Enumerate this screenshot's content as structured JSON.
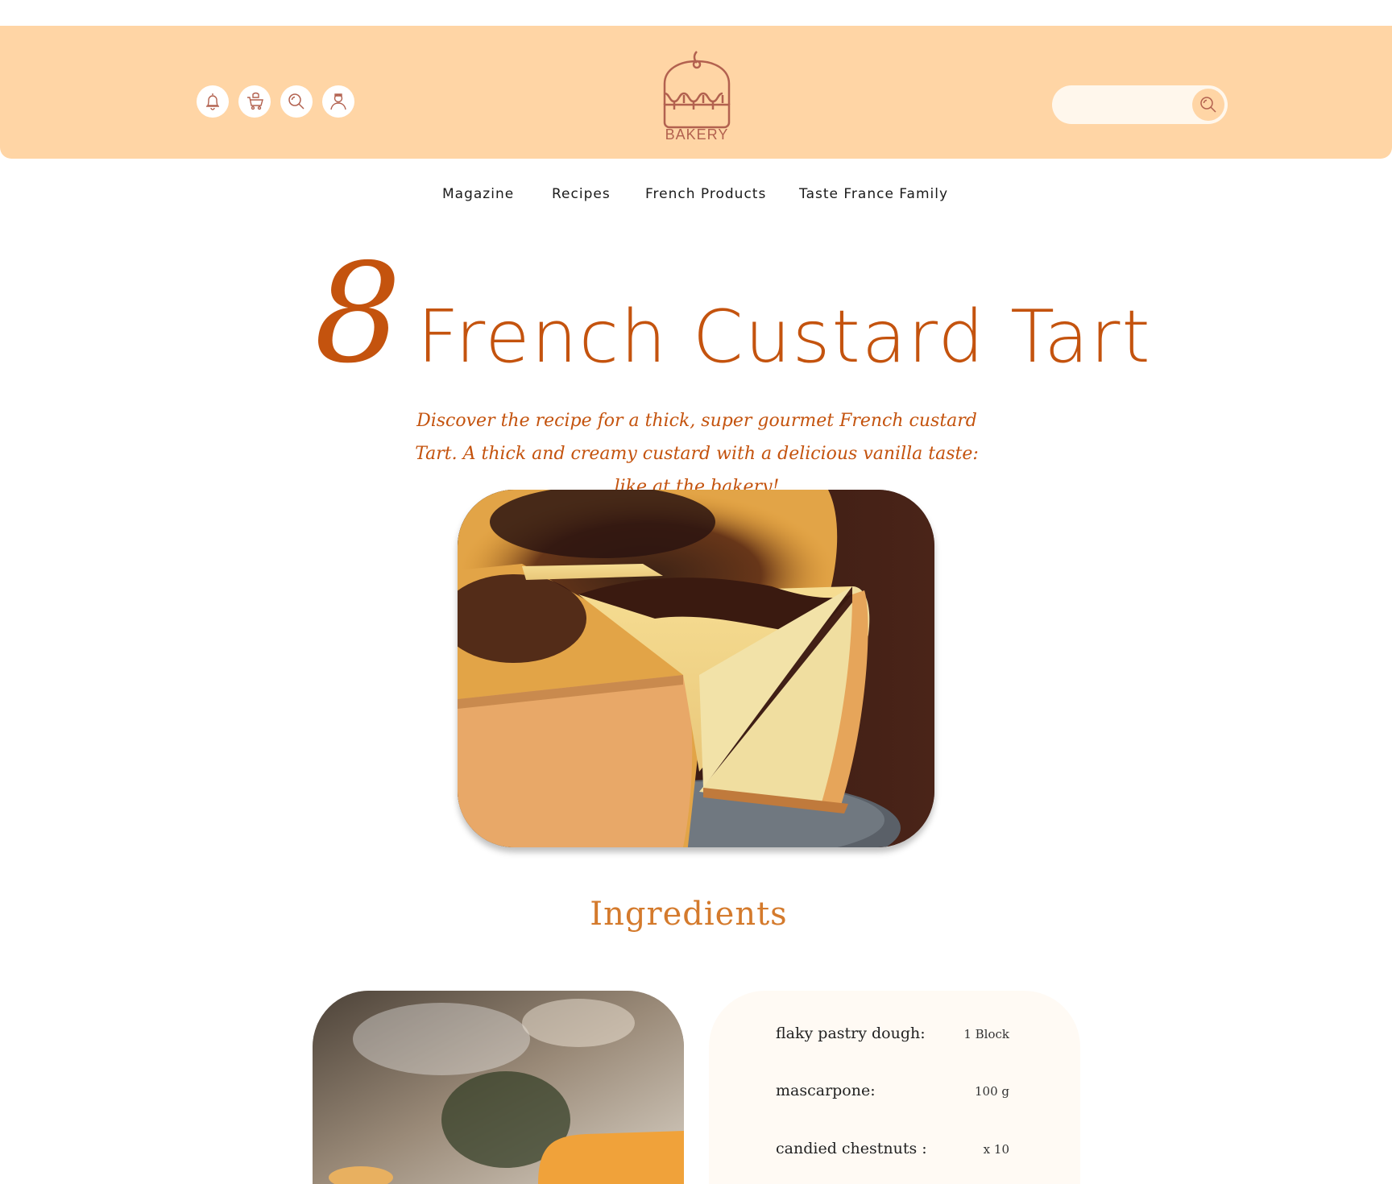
{
  "header": {
    "icons": [
      "bell-icon",
      "cart-icon",
      "search-icon",
      "user-icon"
    ],
    "logo_text": "BAKERY",
    "search": {
      "placeholder": "",
      "value": ""
    },
    "colors": {
      "header_bg": "#ffd5a5",
      "icon_stroke": "#b2614f"
    }
  },
  "nav": {
    "items": [
      "Magazine",
      "Recipes",
      "French Products",
      "Taste France Family"
    ]
  },
  "recipe": {
    "number": "8",
    "title": "French Custard Tart",
    "subtitle": "Discover the recipe for a thick, super gourmet French custard Tart. A thick and creamy custard with a delicious vanilla taste: like at the bakery!",
    "accent_color": "#c4530e"
  },
  "ingredients": {
    "title": "Ingredients",
    "items": [
      {
        "name": "flaky pastry dough:",
        "qty": "1 Block"
      },
      {
        "name": "mascarpone:",
        "qty": "100 g"
      },
      {
        "name": "candied chestnuts :",
        "qty": "x 10"
      }
    ]
  }
}
